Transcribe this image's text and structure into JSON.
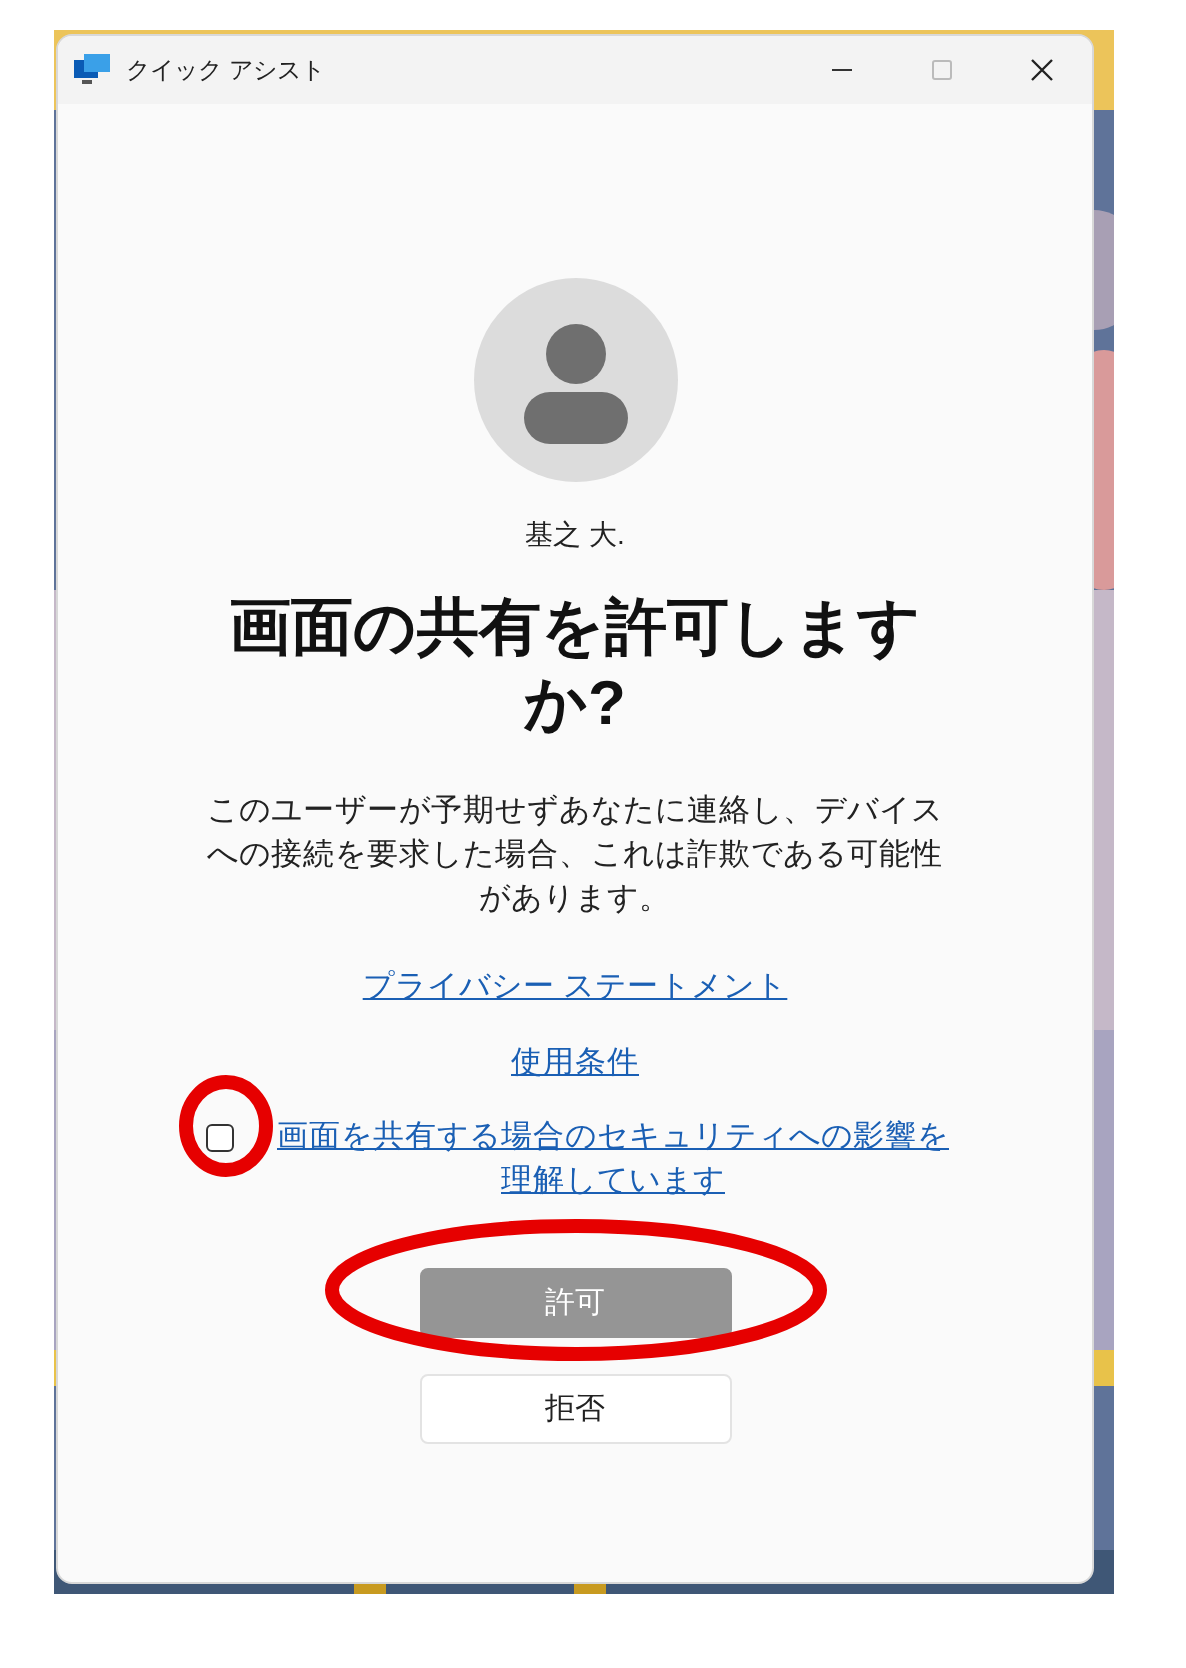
{
  "window": {
    "title": "クイック アシスト"
  },
  "user": {
    "name": "基之 大."
  },
  "heading": "画面の共有を許可しますか?",
  "message": "このユーザーが予期せずあなたに連絡し、デバイスへの接続を要求した場合、これは詐欺である可能性があります。",
  "links": [
    "プライバシー ステートメント",
    "使用条件"
  ],
  "consent": {
    "label": "画面を共有する場合のセキュリティへの影響を理解しています",
    "checked": false
  },
  "buttons": [
    {
      "label": "許可",
      "kind": "primary",
      "disabled": true
    },
    {
      "label": "拒否",
      "kind": "secondary",
      "disabled": false
    }
  ]
}
